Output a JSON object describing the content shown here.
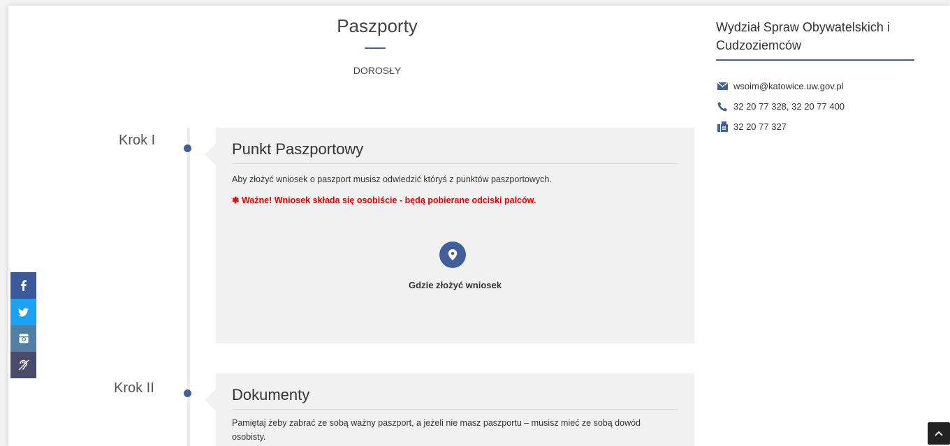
{
  "page": {
    "title": "Paszporty",
    "subtitle": "DOROSŁY"
  },
  "steps": [
    {
      "label": "Krok I",
      "title": "Punkt Paszportowy",
      "text": "Aby złożyć wniosek o paszport musisz odwiedzić któryś z punktów paszportowych.",
      "warning": "Ważne! Wniosek składa się osobiście - będą pobierane odciski palców.",
      "warning_icon": "asterisk-icon",
      "action_label": "Gdzie złożyć wniosek",
      "action_icon": "map-marker-icon"
    },
    {
      "label": "Krok II",
      "title": "Dokumenty",
      "text": "Pamiętaj żeby zabrać ze sobą ważny paszport, a jeżeli nie masz paszportu – musisz mieć ze sobą dowód osobisty."
    }
  ],
  "sidebar": {
    "title": "Wydział Spraw Obywatelskich i Cudzoziemców",
    "contacts": [
      {
        "icon": "envelope-icon",
        "text": "wsoim@katowice.uw.gov.pl"
      },
      {
        "icon": "phone-icon",
        "text": "32 20 77 328, 32 20 77 400"
      },
      {
        "icon": "fax-icon",
        "text": "32 20 77 327"
      }
    ]
  },
  "social": [
    {
      "icon": "facebook-icon",
      "color": "#3b5998"
    },
    {
      "icon": "twitter-icon",
      "color": "#1da1f2"
    },
    {
      "icon": "instagram-icon",
      "color": "#517fa4"
    },
    {
      "icon": "accessibility-hearing-icon",
      "color": "#4a4a6a"
    }
  ],
  "colors": {
    "accent": "#41609a",
    "warning": "#e60000",
    "card_bg": "#f1f1f1"
  },
  "scroll_top_icon": "chevron-up-icon"
}
